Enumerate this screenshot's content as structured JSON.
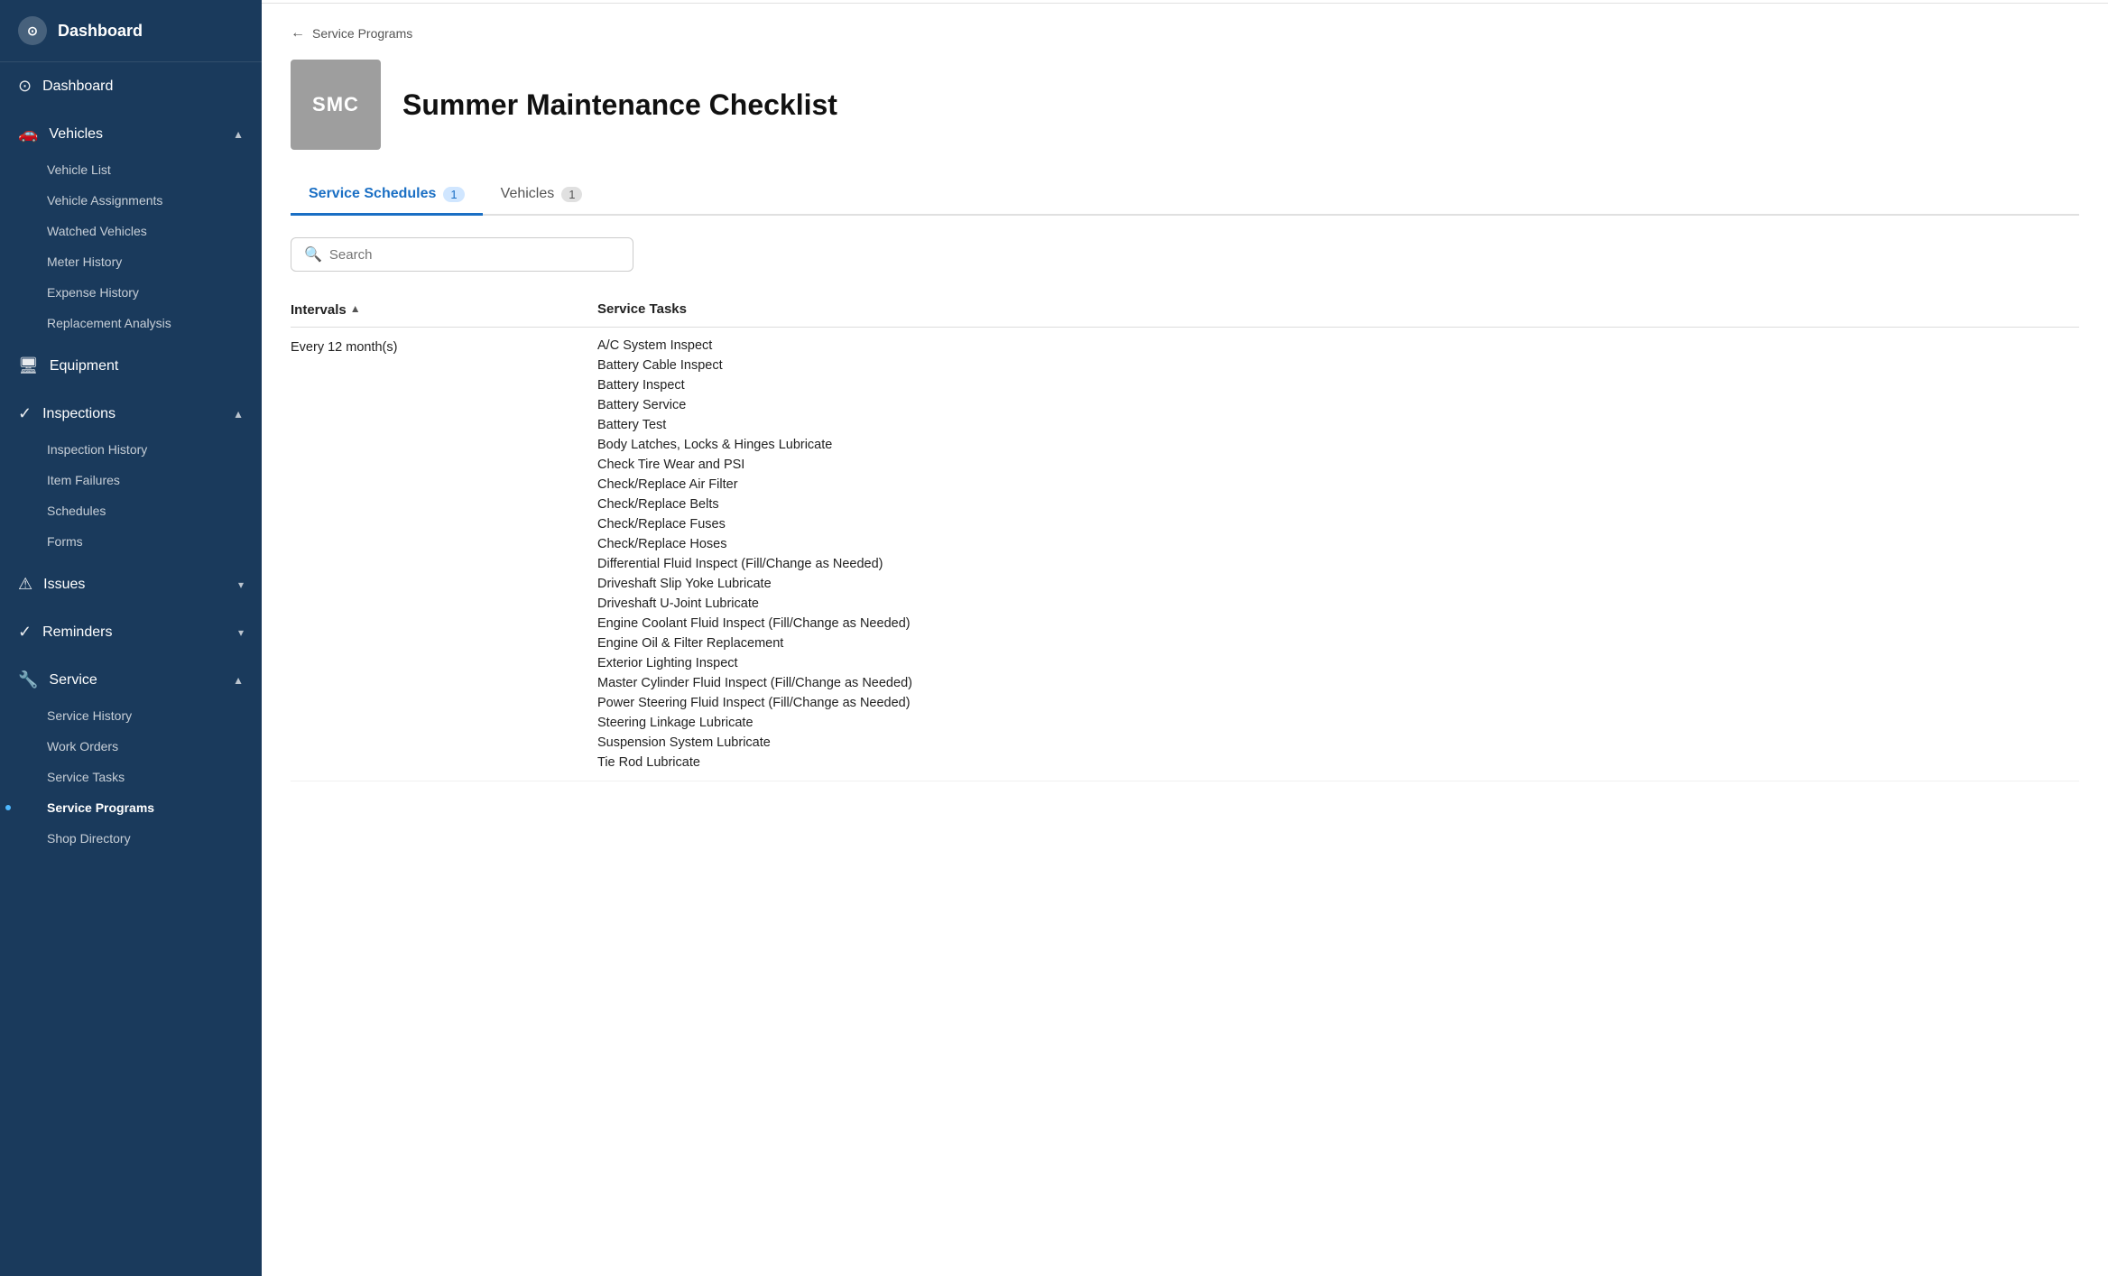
{
  "sidebar": {
    "logo": {
      "icon": "🚗",
      "label": "Dashboard"
    },
    "nav": [
      {
        "id": "dashboard",
        "label": "Dashboard",
        "icon": "⊙",
        "expanded": false,
        "children": []
      },
      {
        "id": "vehicles",
        "label": "Vehicles",
        "icon": "🚗",
        "expanded": true,
        "children": [
          {
            "id": "vehicle-list",
            "label": "Vehicle List",
            "active": false
          },
          {
            "id": "vehicle-assignments",
            "label": "Vehicle Assignments",
            "active": false
          },
          {
            "id": "watched-vehicles",
            "label": "Watched Vehicles",
            "active": false
          },
          {
            "id": "meter-history",
            "label": "Meter History",
            "active": false
          },
          {
            "id": "expense-history",
            "label": "Expense History",
            "active": false
          },
          {
            "id": "replacement-analysis",
            "label": "Replacement Analysis",
            "active": false
          }
        ]
      },
      {
        "id": "equipment",
        "label": "Equipment",
        "icon": "🔧",
        "expanded": false,
        "children": []
      },
      {
        "id": "inspections",
        "label": "Inspections",
        "icon": "✓",
        "expanded": true,
        "children": [
          {
            "id": "inspection-history",
            "label": "Inspection History",
            "active": false
          },
          {
            "id": "item-failures",
            "label": "Item Failures",
            "active": false
          },
          {
            "id": "schedules",
            "label": "Schedules",
            "active": false
          },
          {
            "id": "forms",
            "label": "Forms",
            "active": false
          }
        ]
      },
      {
        "id": "issues",
        "label": "Issues",
        "icon": "⚠",
        "expanded": false,
        "children": []
      },
      {
        "id": "reminders",
        "label": "Reminders",
        "icon": "✓",
        "expanded": false,
        "children": []
      },
      {
        "id": "service",
        "label": "Service",
        "icon": "🔧",
        "expanded": true,
        "children": [
          {
            "id": "service-history",
            "label": "Service History",
            "active": false
          },
          {
            "id": "work-orders",
            "label": "Work Orders",
            "active": false
          },
          {
            "id": "service-tasks",
            "label": "Service Tasks",
            "active": false
          },
          {
            "id": "service-programs",
            "label": "Service Programs",
            "active": true
          },
          {
            "id": "shop-directory",
            "label": "Shop Directory",
            "active": false
          }
        ]
      }
    ]
  },
  "breadcrumb": {
    "back_label": "Service Programs"
  },
  "page": {
    "avatar_text": "SMC",
    "title": "Summer Maintenance Checklist"
  },
  "tabs": [
    {
      "id": "service-schedules",
      "label": "Service Schedules",
      "count": 1,
      "active": true
    },
    {
      "id": "vehicles",
      "label": "Vehicles",
      "count": 1,
      "active": false
    }
  ],
  "search": {
    "placeholder": "Search"
  },
  "table": {
    "columns": [
      {
        "id": "intervals",
        "label": "Intervals",
        "sortable": true
      },
      {
        "id": "service-tasks",
        "label": "Service Tasks",
        "sortable": false
      }
    ],
    "rows": [
      {
        "interval": "Every 12 month(s)",
        "tasks": [
          "A/C System Inspect",
          "Battery Cable Inspect",
          "Battery Inspect",
          "Battery Service",
          "Battery Test",
          "Body Latches, Locks & Hinges Lubricate",
          "Check Tire Wear and PSI",
          "Check/Replace Air Filter",
          "Check/Replace Belts",
          "Check/Replace Fuses",
          "Check/Replace Hoses",
          "Differential Fluid Inspect (Fill/Change as Needed)",
          "Driveshaft Slip Yoke Lubricate",
          "Driveshaft U-Joint Lubricate",
          "Engine Coolant Fluid Inspect (Fill/Change as Needed)",
          "Engine Oil & Filter Replacement",
          "Exterior Lighting Inspect",
          "Master Cylinder Fluid Inspect (Fill/Change as Needed)",
          "Power Steering Fluid Inspect (Fill/Change as Needed)",
          "Steering Linkage Lubricate",
          "Suspension System Lubricate",
          "Tie Rod Lubricate"
        ]
      }
    ]
  }
}
